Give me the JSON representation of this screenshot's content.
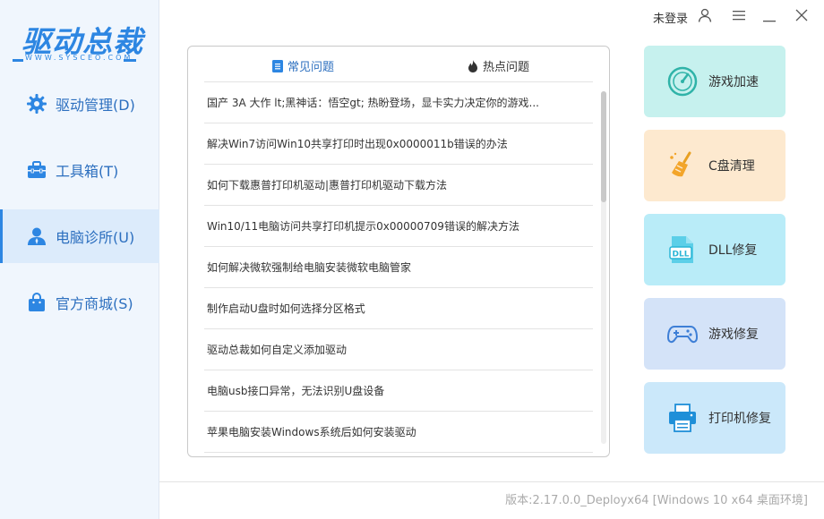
{
  "logo": {
    "text": "驱动总裁",
    "subtext": "WWW.SYSCEO.COM"
  },
  "sidebar": {
    "items": [
      {
        "label": "驱动管理(D)",
        "icon": "gear-icon"
      },
      {
        "label": "工具箱(T)",
        "icon": "toolbox-icon"
      },
      {
        "label": "电脑诊所(U)",
        "icon": "user-icon",
        "active": true
      },
      {
        "label": "官方商城(S)",
        "icon": "shopping-bag-icon"
      }
    ]
  },
  "topbar": {
    "login": "未登录"
  },
  "tabs": [
    {
      "label": "常见问题",
      "icon": "document-icon"
    },
    {
      "label": "热点问题",
      "icon": "fire-icon"
    }
  ],
  "articles": [
    "国产 3A 大作 lt;黑神话：悟空gt; 热盼登场，显卡实力决定你的游戏...",
    "解决Win7访问Win10共享打印时出现0x0000011b错误的办法",
    "如何下载惠普打印机驱动|惠普打印机驱动下载方法",
    "Win10/11电脑访问共享打印机提示0x00000709错误的解决方法",
    "如何解决微软强制给电脑安装微软电脑管家",
    "制作启动U盘时如何选择分区格式",
    "驱动总裁如何自定义添加驱动",
    "电脑usb接口异常，无法识别U盘设备",
    "苹果电脑安装Windows系统后如何安装驱动"
  ],
  "tools": [
    {
      "label": "游戏加速",
      "icon": "speedometer-icon",
      "bg": "#c6f1ee"
    },
    {
      "label": "C盘清理",
      "icon": "broom-icon",
      "bg": "#fde9cf"
    },
    {
      "label": "DLL修复",
      "icon": "dll-file-icon",
      "bg": "#b9ecf8"
    },
    {
      "label": "游戏修复",
      "icon": "gamepad-icon",
      "bg": "#d4e3f8"
    },
    {
      "label": "打印机修复",
      "icon": "printer-icon",
      "bg": "#cbe8fa"
    }
  ],
  "footer": {
    "version": "版本:2.17.0.0_Deployx64 [Windows 10 x64 桌面环境]"
  }
}
